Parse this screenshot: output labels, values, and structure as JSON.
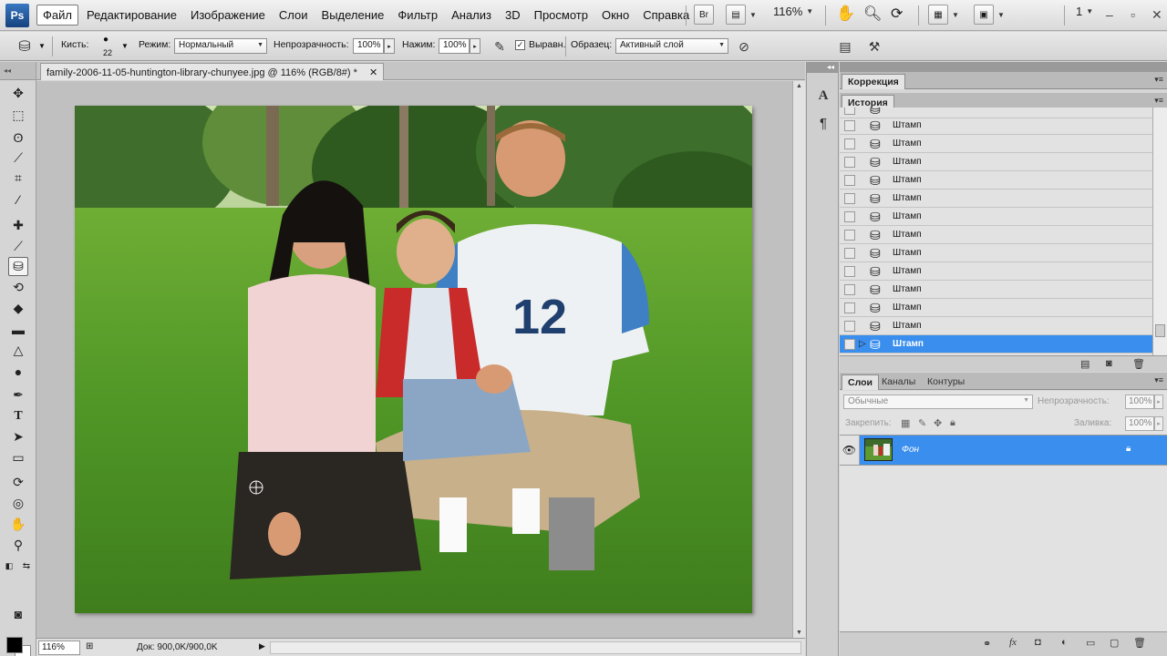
{
  "app": {
    "logo": "Ps"
  },
  "menu": [
    "Файл",
    "Редактирование",
    "Изображение",
    "Слои",
    "Выделение",
    "Фильтр",
    "Анализ",
    "3D",
    "Просмотр",
    "Окно",
    "Справка"
  ],
  "menubar_right": {
    "bridge": "Br",
    "zoom": "116%",
    "workspace": "1"
  },
  "options": {
    "brush_label": "Кисть:",
    "brush_size": "22",
    "mode_label": "Режим:",
    "mode_value": "Нормальный",
    "opacity_label": "Непрозрачность:",
    "opacity_value": "100%",
    "pressure_label": "Нажим:",
    "pressure_value": "100%",
    "aligned_label": "Выравн.",
    "aligned_checked": true,
    "sample_label": "Образец:",
    "sample_value": "Активный слой"
  },
  "document": {
    "tab_title": "family-2006-11-05-huntington-library-chunyee.jpg @ 116% (RGB/8#) *",
    "close": "✕"
  },
  "status": {
    "zoom": "116%",
    "doc_info": "Док: 900,0K/900,0K"
  },
  "panels": {
    "correction_tab": "Коррекция",
    "history_tab": "История",
    "history_items": [
      "Штамп",
      "Штамп",
      "Штамп",
      "Штамп",
      "Штамп",
      "Штамп",
      "Штамп",
      "Штамп",
      "Штамп",
      "Штамп",
      "Штамп",
      "Штамп",
      "Штамп"
    ],
    "layers_tabs": [
      "Слои",
      "Каналы",
      "Контуры"
    ],
    "blend_mode": "Обычные",
    "opacity_label": "Непрозрачность:",
    "opacity_value": "100%",
    "lock_label": "Закрепить:",
    "fill_label": "Заливка:",
    "fill_value": "100%",
    "layer_name": "Фон"
  },
  "colors": {
    "selection": "#3a8eed",
    "foreground": "#000000",
    "background": "#ffffff"
  }
}
